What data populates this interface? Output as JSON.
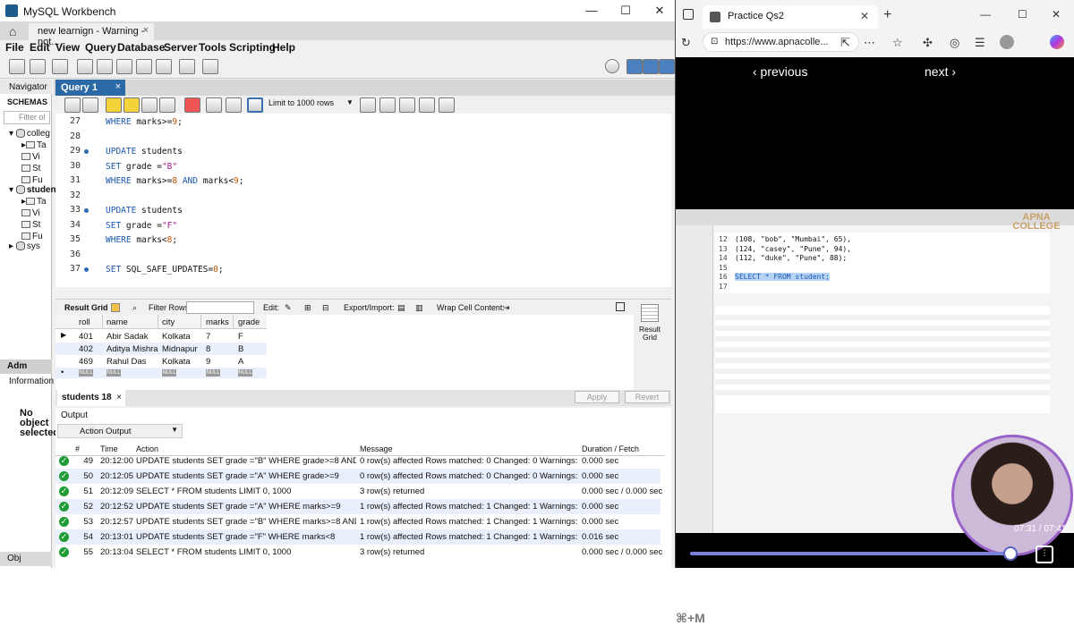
{
  "workbench": {
    "window_title": "MySQL Workbench",
    "connection_tab": "new learnign - Warning - not...",
    "menu": [
      "File",
      "Edit",
      "View",
      "Query",
      "Database",
      "Server",
      "Tools",
      "Scripting",
      "Help"
    ],
    "navigator": {
      "header": "Navigator",
      "schemas_label": "SCHEMAS",
      "filter_placeholder": "Filter ol",
      "tree": [
        {
          "label": "colleg",
          "kind": "db"
        },
        {
          "label": "Ta",
          "kind": "folder"
        },
        {
          "label": "Vi",
          "kind": "folder"
        },
        {
          "label": "St",
          "kind": "folder"
        },
        {
          "label": "Fu",
          "kind": "folder"
        },
        {
          "label": "studen",
          "kind": "db"
        },
        {
          "label": "Ta",
          "kind": "folder"
        },
        {
          "label": "Vi",
          "kind": "folder"
        },
        {
          "label": "St",
          "kind": "folder"
        },
        {
          "label": "Fu",
          "kind": "folder"
        },
        {
          "label": "sys",
          "kind": "db"
        }
      ],
      "admin_tab": "Adm",
      "information_label": "Information",
      "no_object": "No object selected",
      "object_tab": "Obj"
    },
    "query_tab": "Query 1",
    "limit_label": "Limit to 1000 rows",
    "editor_lines": [
      {
        "n": "27",
        "dot": false,
        "parts": [
          {
            "t": "WHERE ",
            "c": "kw"
          },
          {
            "t": "marks>=",
            "c": ""
          },
          {
            "t": "9",
            "c": "num"
          },
          {
            "t": ";",
            "c": ""
          }
        ]
      },
      {
        "n": "28",
        "dot": false,
        "parts": []
      },
      {
        "n": "29",
        "dot": true,
        "parts": [
          {
            "t": "UPDATE ",
            "c": "kw"
          },
          {
            "t": "students",
            "c": ""
          }
        ]
      },
      {
        "n": "30",
        "dot": false,
        "parts": [
          {
            "t": "SET ",
            "c": "kw"
          },
          {
            "t": "grade =",
            "c": ""
          },
          {
            "t": "\"B\"",
            "c": "str"
          }
        ]
      },
      {
        "n": "31",
        "dot": false,
        "parts": [
          {
            "t": "WHERE ",
            "c": "kw"
          },
          {
            "t": "marks>=",
            "c": ""
          },
          {
            "t": "8",
            "c": "num"
          },
          {
            "t": " AND ",
            "c": "kw"
          },
          {
            "t": "marks<",
            "c": ""
          },
          {
            "t": "9",
            "c": "num"
          },
          {
            "t": ";",
            "c": ""
          }
        ]
      },
      {
        "n": "32",
        "dot": false,
        "parts": []
      },
      {
        "n": "33",
        "dot": true,
        "parts": [
          {
            "t": "UPDATE ",
            "c": "kw"
          },
          {
            "t": "students",
            "c": ""
          }
        ]
      },
      {
        "n": "34",
        "dot": false,
        "parts": [
          {
            "t": "SET ",
            "c": "kw"
          },
          {
            "t": "grade =",
            "c": ""
          },
          {
            "t": "\"F\"",
            "c": "str"
          }
        ]
      },
      {
        "n": "35",
        "dot": false,
        "parts": [
          {
            "t": "WHERE ",
            "c": "kw"
          },
          {
            "t": "marks<",
            "c": ""
          },
          {
            "t": "8",
            "c": "num"
          },
          {
            "t": ";",
            "c": ""
          }
        ]
      },
      {
        "n": "36",
        "dot": false,
        "parts": []
      },
      {
        "n": "37",
        "dot": true,
        "parts": [
          {
            "t": "SET ",
            "c": "kw"
          },
          {
            "t": "SQL_SAFE_UPDATES=",
            "c": ""
          },
          {
            "t": "0",
            "c": "num"
          },
          {
            "t": ";",
            "c": ""
          }
        ]
      }
    ],
    "result_bar": {
      "result_grid": "Result Grid",
      "filter_rows": "Filter Rows:",
      "edit": "Edit:",
      "export_import": "Export/Import:",
      "wrap": "Wrap Cell Content:",
      "side_label": "Result Grid"
    },
    "grid": {
      "columns": [
        "roll",
        "name",
        "city",
        "marks",
        "grade"
      ],
      "rows": [
        [
          "401",
          "Abir Sadak",
          "Kolkata",
          "7",
          "F"
        ],
        [
          "402",
          "Aditya Mishra",
          "Midnapur",
          "8",
          "B"
        ],
        [
          "469",
          "Rahul Das",
          "Kolkata",
          "9",
          "A"
        ]
      ],
      "null_label": "NULL"
    },
    "students_tab": "students 18",
    "apply": "Apply",
    "revert": "Revert",
    "output": {
      "title": "Output",
      "selector": "Action Output",
      "headers": [
        "#",
        "Time",
        "Action",
        "Message",
        "Duration / Fetch"
      ],
      "rows": [
        [
          "49",
          "20:12:00",
          "UPDATE students  SET grade =\"B\" WHERE grade>=8 AND gr...",
          "0 row(s) affected Rows matched: 0  Changed: 0  Warnings: 0",
          "0.000 sec"
        ],
        [
          "50",
          "20:12:05",
          "UPDATE students SET grade =\"A\" WHERE grade>=9",
          "0 row(s) affected Rows matched: 0  Changed: 0  Warnings: 0",
          "0.000 sec"
        ],
        [
          "51",
          "20:12:09",
          "SELECT * FROM students LIMIT 0, 1000",
          "3 row(s) returned",
          "0.000 sec / 0.000 sec"
        ],
        [
          "52",
          "20:12:52",
          "UPDATE students SET grade =\"A\" WHERE marks>=9",
          "1 row(s) affected Rows matched: 1  Changed: 1  Warnings: 0",
          "0.000 sec"
        ],
        [
          "53",
          "20:12:57",
          "UPDATE students  SET grade =\"B\" WHERE marks>=8 AND m...",
          "1 row(s) affected Rows matched: 1  Changed: 1  Warnings: 0",
          "0.000 sec"
        ],
        [
          "54",
          "20:13:01",
          "UPDATE students SET grade =\"F\" WHERE marks<8",
          "1 row(s) affected Rows matched: 1  Changed: 1  Warnings: 0",
          "0.016 sec"
        ],
        [
          "55",
          "20:13:04",
          "SELECT * FROM students LIMIT 0, 1000",
          "3 row(s) returned",
          "0.000 sec / 0.000 sec"
        ]
      ]
    }
  },
  "browser": {
    "tab_title": "Practice Qs2",
    "url": "https://www.apnacolle...",
    "previous": "‹ previous",
    "next": "next ›",
    "video": {
      "logo": "APNA COLLEGE",
      "lines": [
        {
          "n": "12",
          "t": "(108, \"bob\", \"Mumbai\", 65),"
        },
        {
          "n": "13",
          "t": "(124, \"casey\", \"Pune\", 94),"
        },
        {
          "n": "14",
          "t": "(112, \"duke\", \"Pune\", 88);"
        },
        {
          "n": "15",
          "t": ""
        },
        {
          "n": "16",
          "t": "SELECT * FROM student;"
        },
        {
          "n": "17",
          "t": ""
        }
      ],
      "timestamp": "07:31 / 07:41",
      "progress": 0.979,
      "shortcut": "⌘+M"
    }
  }
}
